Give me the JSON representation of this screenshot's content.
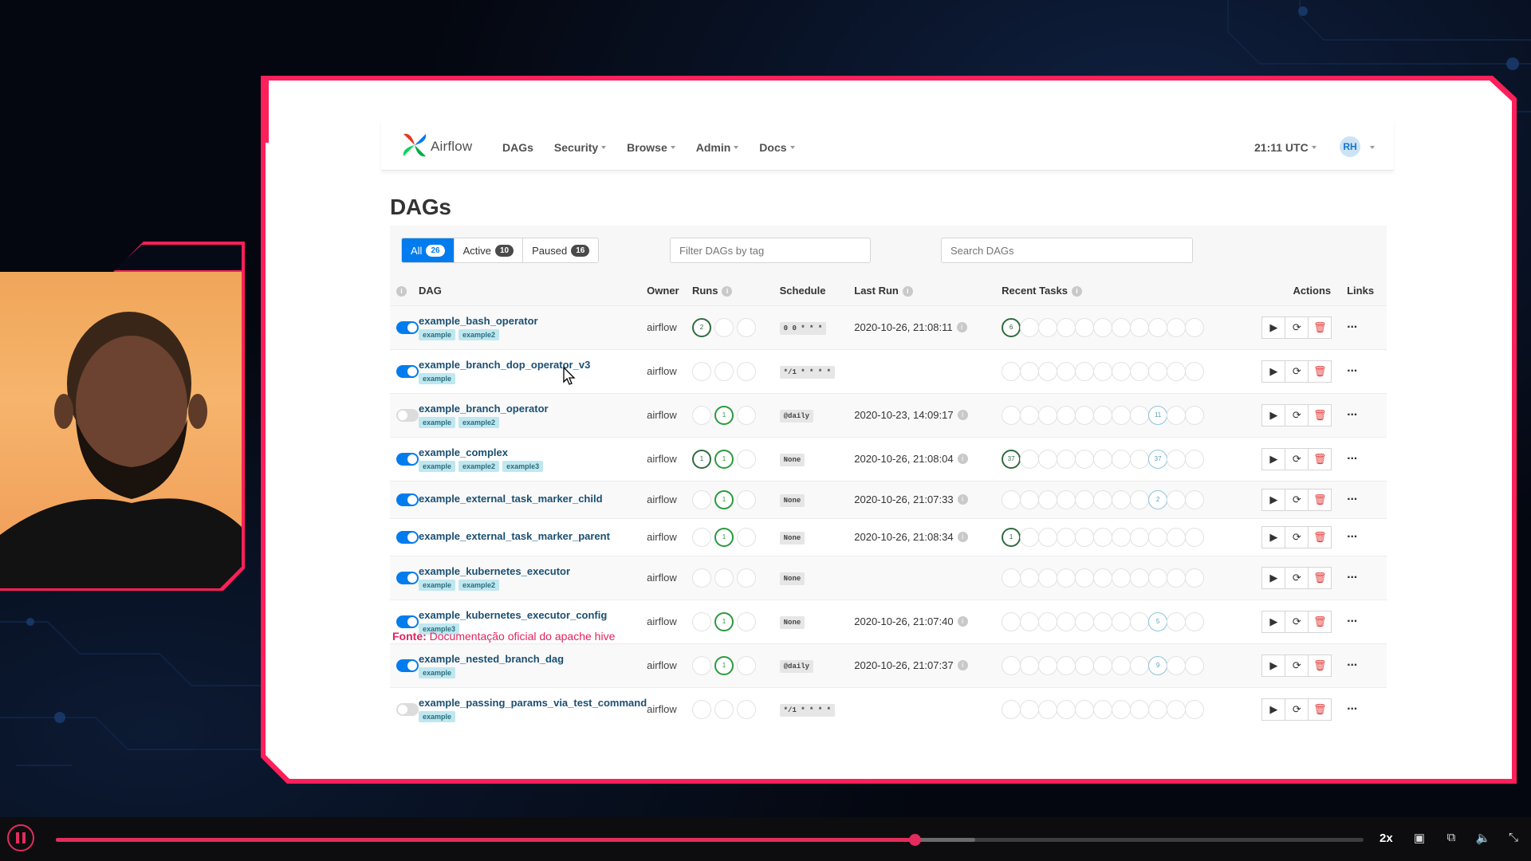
{
  "nav": {
    "brand": "Airflow",
    "items": [
      "DAGs",
      "Security",
      "Browse",
      "Admin",
      "Docs"
    ],
    "time": "21:11 UTC",
    "user_initials": "RH"
  },
  "page_title": "DAGs",
  "filters": {
    "tabs": [
      {
        "label": "All",
        "count": "26",
        "active": true
      },
      {
        "label": "Active",
        "count": "10",
        "active": false
      },
      {
        "label": "Paused",
        "count": "16",
        "active": false
      }
    ],
    "tag_filter_placeholder": "Filter DAGs by tag",
    "search_placeholder": "Search DAGs"
  },
  "columns": {
    "dag": "DAG",
    "owner": "Owner",
    "runs": "Runs",
    "schedule": "Schedule",
    "last_run": "Last Run",
    "recent_tasks": "Recent Tasks",
    "actions": "Actions",
    "links": "Links"
  },
  "dags": [
    {
      "enabled": true,
      "name": "example_bash_operator",
      "tags": [
        "example",
        "example2"
      ],
      "owner": "airflow",
      "runs": [
        "2",
        "",
        ""
      ],
      "schedule": "0 0 * * *",
      "last_run": "2020-10-26, 21:08:11",
      "recent": {
        "0": "6"
      }
    },
    {
      "enabled": true,
      "name": "example_branch_dop_operator_v3",
      "tags": [
        "example"
      ],
      "owner": "airflow",
      "runs": [
        "",
        "",
        ""
      ],
      "schedule": "*/1 * * * *",
      "last_run": "",
      "recent": {}
    },
    {
      "enabled": false,
      "name": "example_branch_operator",
      "tags": [
        "example",
        "example2"
      ],
      "owner": "airflow",
      "runs": [
        "",
        "1",
        ""
      ],
      "schedule": "@daily",
      "last_run": "2020-10-23, 14:09:17",
      "recent": {
        "8": "11"
      }
    },
    {
      "enabled": true,
      "name": "example_complex",
      "tags": [
        "example",
        "example2",
        "example3"
      ],
      "owner": "airflow",
      "runs": [
        "1",
        "1",
        ""
      ],
      "schedule": "None",
      "last_run": "2020-10-26, 21:08:04",
      "recent": {
        "0": "37",
        "8": "37"
      }
    },
    {
      "enabled": true,
      "name": "example_external_task_marker_child",
      "tags": [],
      "owner": "airflow",
      "runs": [
        "",
        "1",
        ""
      ],
      "schedule": "None",
      "last_run": "2020-10-26, 21:07:33",
      "recent": {
        "8": "2"
      }
    },
    {
      "enabled": true,
      "name": "example_external_task_marker_parent",
      "tags": [],
      "owner": "airflow",
      "runs": [
        "",
        "1",
        ""
      ],
      "schedule": "None",
      "last_run": "2020-10-26, 21:08:34",
      "recent": {
        "0": "1"
      }
    },
    {
      "enabled": true,
      "name": "example_kubernetes_executor",
      "tags": [
        "example",
        "example2"
      ],
      "owner": "airflow",
      "runs": [
        "",
        "",
        ""
      ],
      "schedule": "None",
      "last_run": "",
      "recent": {}
    },
    {
      "enabled": true,
      "name": "example_kubernetes_executor_config",
      "tags": [
        "example3"
      ],
      "owner": "airflow",
      "runs": [
        "",
        "1",
        ""
      ],
      "schedule": "None",
      "last_run": "2020-10-26, 21:07:40",
      "recent": {
        "8": "5"
      }
    },
    {
      "enabled": true,
      "name": "example_nested_branch_dag",
      "tags": [
        "example"
      ],
      "owner": "airflow",
      "runs": [
        "",
        "1",
        ""
      ],
      "schedule": "@daily",
      "last_run": "2020-10-26, 21:07:37",
      "recent": {
        "8": "9"
      }
    },
    {
      "enabled": false,
      "name": "example_passing_params_via_test_command",
      "tags": [
        "example"
      ],
      "owner": "airflow",
      "runs": [
        "",
        "",
        ""
      ],
      "schedule": "*/1 * * * *",
      "last_run": "",
      "recent": {}
    }
  ],
  "source": {
    "label": "Fonte:",
    "text": "Documentação oficial do apache hive"
  },
  "player": {
    "speed": "2x",
    "progress": 0.657,
    "buffered": 0.703
  },
  "colors": {
    "accent": "#ff1f5a",
    "airflow_blue": "#017cee",
    "success": "#2a9a3c"
  }
}
